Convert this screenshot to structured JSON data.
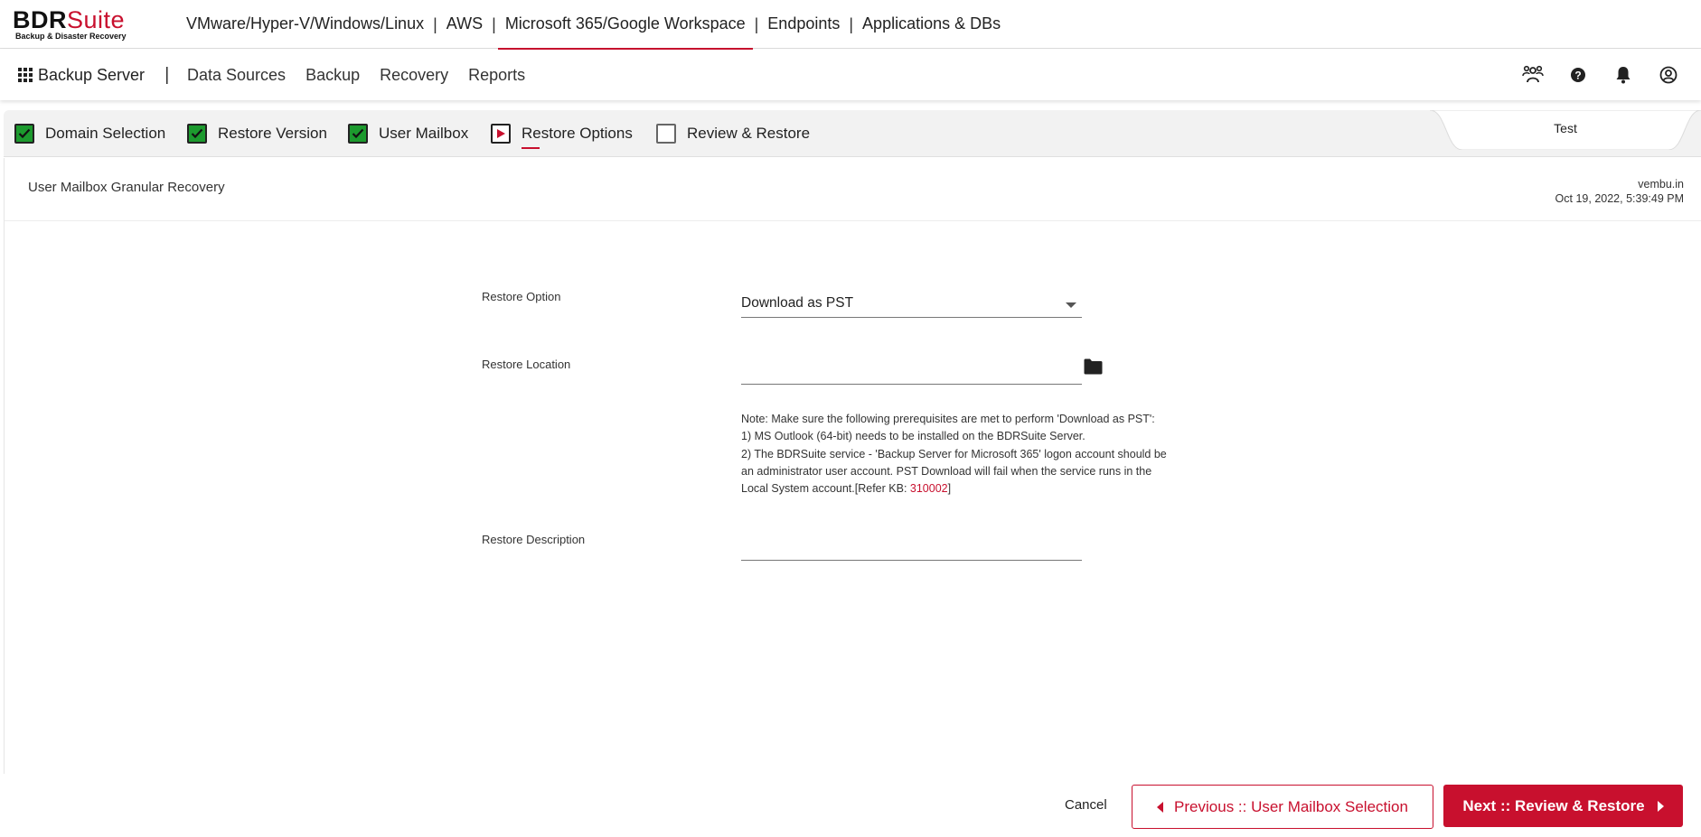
{
  "brand": {
    "name_bold": "BDR",
    "name_light": "Suite",
    "tagline": "Backup & Disaster Recovery"
  },
  "colors": {
    "accent": "#c8102e",
    "done": "#1c9a2e"
  },
  "top_nav": [
    {
      "label": "VMware/Hyper-V/Windows/Linux",
      "active": false
    },
    {
      "label": "AWS",
      "active": false
    },
    {
      "label": "Microsoft 365/Google Workspace",
      "active": true
    },
    {
      "label": "Endpoints",
      "active": false
    },
    {
      "label": "Applications & DBs",
      "active": false
    }
  ],
  "separator": "|",
  "server": {
    "label": "Backup Server"
  },
  "sub_nav": [
    "Data Sources",
    "Backup",
    "Recovery",
    "Reports"
  ],
  "header_icons": [
    "users-icon",
    "help-icon",
    "bell-icon",
    "user-icon"
  ],
  "steps": [
    {
      "label": "Domain Selection",
      "state": "done"
    },
    {
      "label": "Restore Version",
      "state": "done"
    },
    {
      "label": "User Mailbox",
      "state": "done"
    },
    {
      "label": "Restore Options",
      "state": "current"
    },
    {
      "label": "Review & Restore",
      "state": "pending"
    }
  ],
  "tab": {
    "label": "Test"
  },
  "page": {
    "title": "User Mailbox Granular Recovery",
    "domain": "vembu.in",
    "timestamp": "Oct 19, 2022, 5:39:49 PM"
  },
  "form": {
    "restore_option_label": "Restore Option",
    "restore_option_value": "Download as PST",
    "restore_location_label": "Restore Location",
    "restore_location_value": "",
    "restore_description_label": "Restore Description",
    "restore_description_value": "",
    "note_line1": "Note: Make sure the following prerequisites are met to perform 'Download as PST':",
    "note_line2": "1) MS Outlook (64-bit) needs to be installed on the BDRSuite Server.",
    "note_line3": "2) The BDRSuite service - 'Backup Server for Microsoft 365' logon account should be",
    "note_line4": "an administrator user account. PST Download will fail when the service runs in the",
    "note_line5_prefix": "Local System account.[Refer KB: ",
    "note_kb": "310002",
    "note_line5_suffix": "]"
  },
  "footer": {
    "cancel": "Cancel",
    "previous": "Previous :: User Mailbox Selection",
    "next": "Next :: Review & Restore"
  }
}
